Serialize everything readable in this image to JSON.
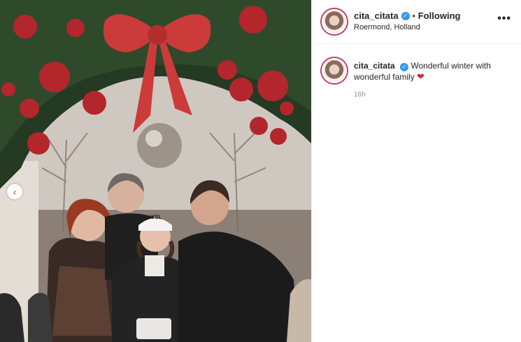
{
  "post": {
    "username": "cita_citata",
    "follow_status": "Following",
    "location": "Roermond, Holland",
    "more_label": "•••",
    "caption_text": "Wonderful winter with wonderful family",
    "heart_emoji": "❤",
    "timestamp": "16h",
    "verified_icon": "check-badge-icon",
    "photo_cap_text": "YSL"
  },
  "carousel": {
    "prev_label": "‹"
  },
  "colors": {
    "verified": "#3897f0",
    "heart": "#d7263d",
    "ring": "#c9356b"
  }
}
